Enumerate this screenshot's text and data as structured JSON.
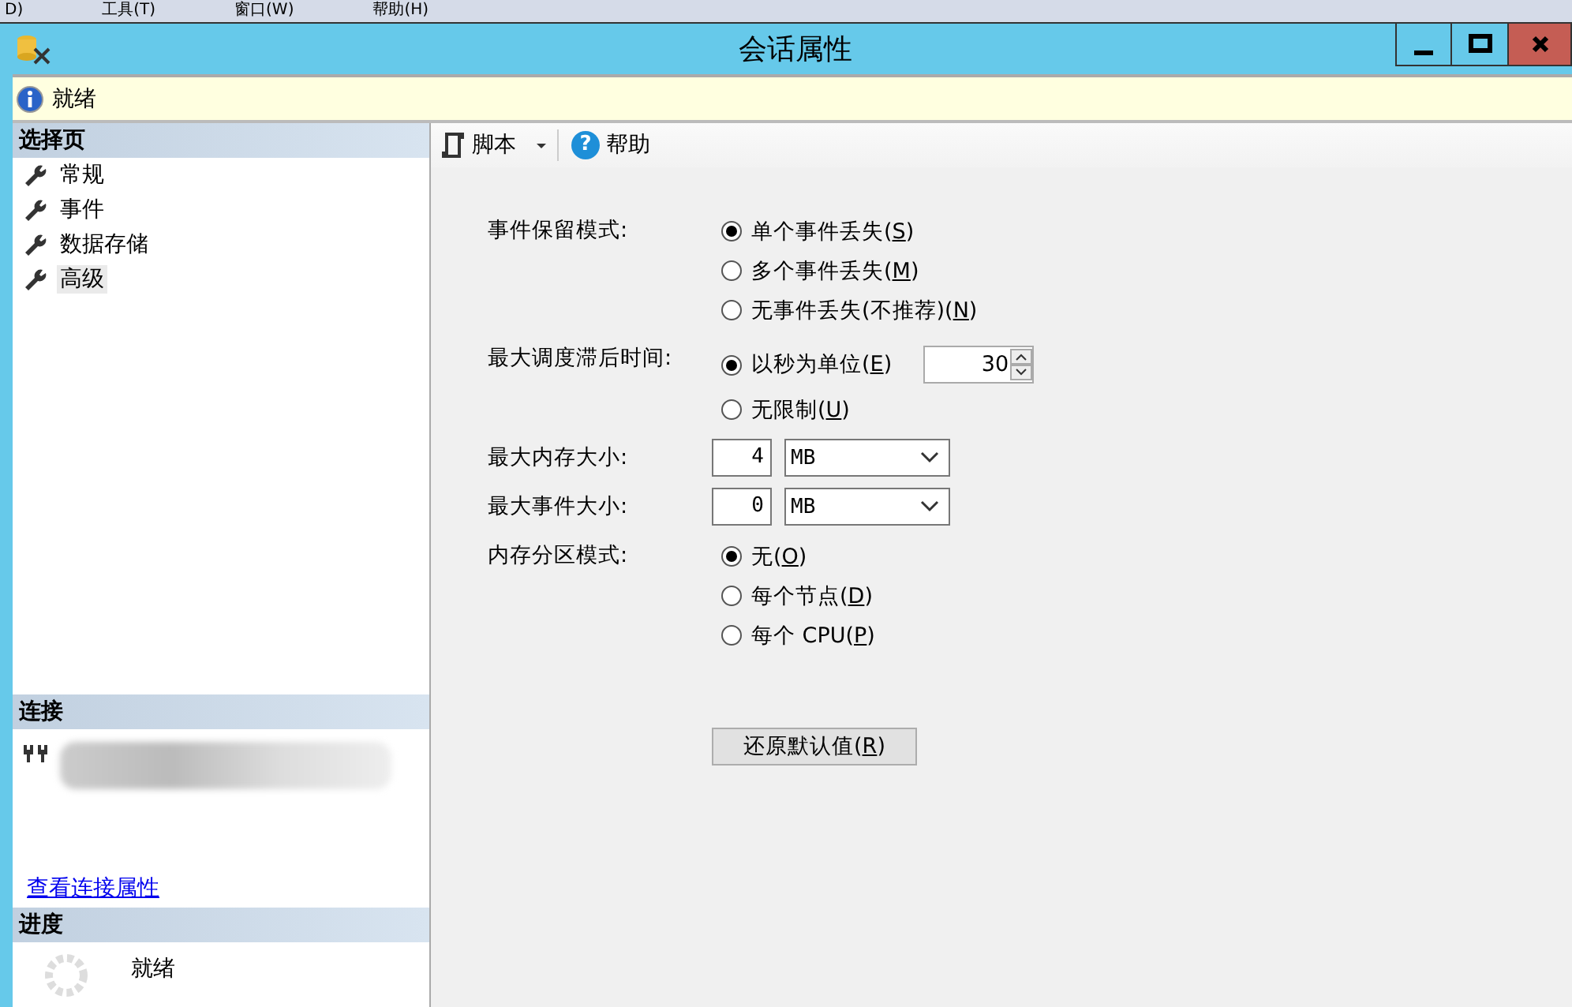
{
  "menu_bar": [
    "D)",
    "工具(T)",
    "窗口(W)",
    "帮助(H)"
  ],
  "window": {
    "title": "会话属性"
  },
  "info_bar": {
    "text": "就绪"
  },
  "sidebar": {
    "header": "选择页",
    "items": [
      {
        "label": "常规",
        "selected": false
      },
      {
        "label": "事件",
        "selected": false
      },
      {
        "label": "数据存储",
        "selected": false
      },
      {
        "label": "高级",
        "selected": true
      }
    ]
  },
  "connection": {
    "header": "连接",
    "link": "查看连接属性"
  },
  "progress": {
    "header": "进度",
    "status": "就绪"
  },
  "toolbar": {
    "script": "脚本",
    "help_icon": "?",
    "help": "帮助"
  },
  "form": [
    {
      "kind": "radio",
      "label": "事件保留模式:",
      "options": [
        {
          "text": "单个事件丢失(",
          "mnemonic": "S",
          "after": ")",
          "selected": true
        },
        {
          "text": "多个事件丢失(",
          "mnemonic": "M",
          "after": ")",
          "selected": false
        },
        {
          "text": "无事件丢失(不推荐)(",
          "mnemonic": "N",
          "after": ")",
          "selected": false
        }
      ]
    },
    {
      "kind": "radio",
      "label": "最大调度滞后时间:",
      "spin_value": "30",
      "options": [
        {
          "text": "以秒为单位(",
          "mnemonic": "E",
          "after": ")",
          "selected": true
        },
        {
          "text": "无限制(",
          "mnemonic": "U",
          "after": ")",
          "selected": false
        }
      ]
    },
    {
      "kind": "size",
      "label": "最大内存大小:",
      "value": "4",
      "unit": "MB"
    },
    {
      "kind": "size",
      "label": "最大事件大小:",
      "value": "0",
      "unit": "MB"
    },
    {
      "kind": "radio",
      "label": "内存分区模式:",
      "options": [
        {
          "text": "无(",
          "mnemonic": "O",
          "after": ")",
          "selected": true
        },
        {
          "text": "每个节点(",
          "mnemonic": "D",
          "after": ")",
          "selected": false
        },
        {
          "text": "每个 CPU(",
          "mnemonic": "P",
          "after": ")",
          "selected": false
        }
      ]
    }
  ],
  "reset_button": {
    "text": "还原默认值(",
    "mnemonic": "R",
    "after": ")"
  }
}
